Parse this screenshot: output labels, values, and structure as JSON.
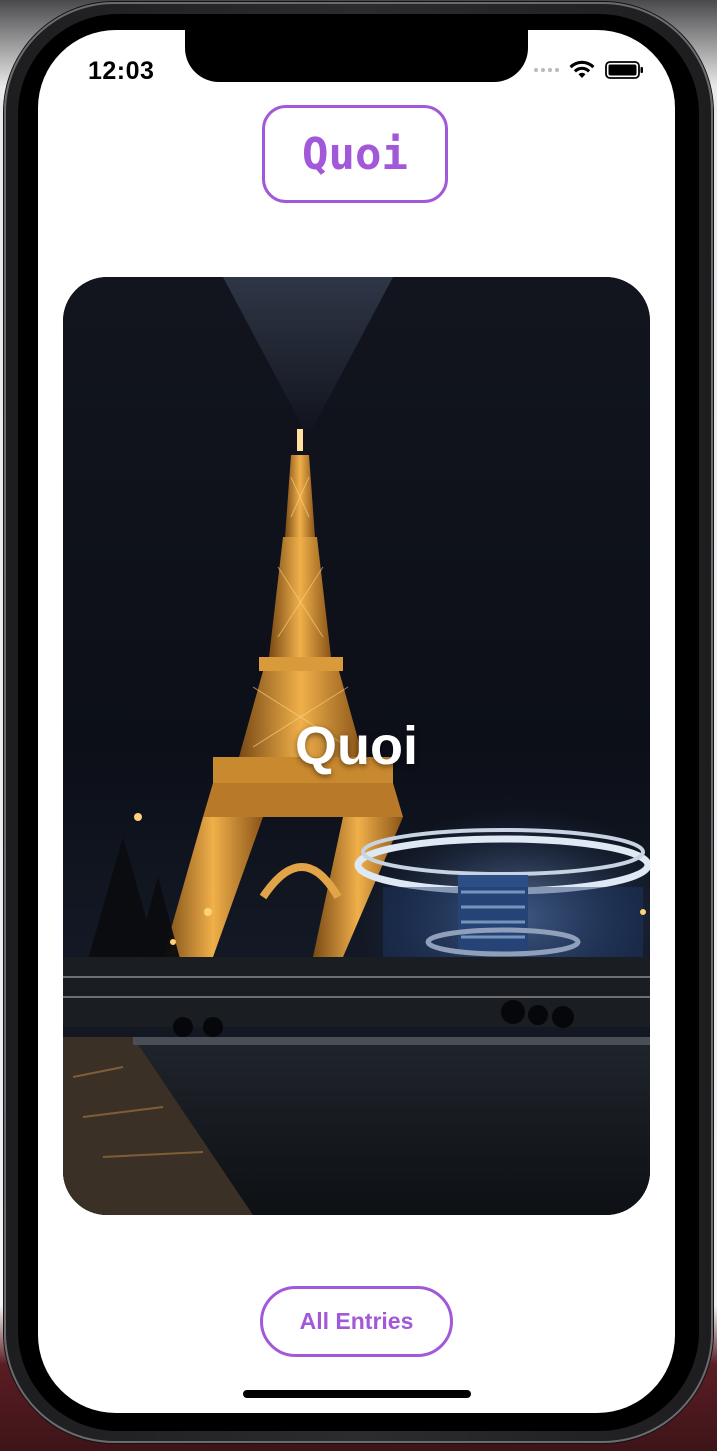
{
  "status_bar": {
    "time": "12:03",
    "icons": [
      "cellular-signal-icon",
      "wifi-icon",
      "battery-icon"
    ]
  },
  "header": {
    "title": "Quoi"
  },
  "card": {
    "label": "Quoi",
    "image": "eiffel-tower-at-night-photo"
  },
  "footer": {
    "all_entries_label": "All Entries"
  },
  "colors": {
    "accent": "#a259d9",
    "background": "#ffffff",
    "text_on_image": "#ffffff"
  }
}
